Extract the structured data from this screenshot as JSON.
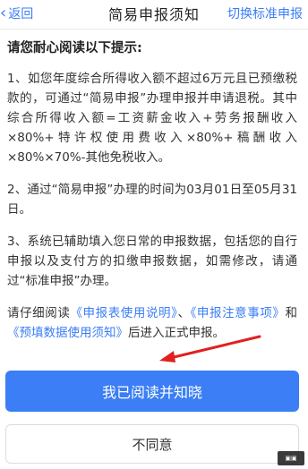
{
  "header": {
    "back_label": "返回",
    "title": "简易申报须知",
    "switch_label": "切换标准申报"
  },
  "notice": {
    "heading": "请您耐心阅读以下提示:",
    "item1": "1、如您年度综合所得收入额不超过6万元且已预缴税款的，可通过“简易申报”办理申报并申请退税。其中综合所得收入额=工资薪金收入+劳务报酬收入×80%+特许权使用费收入×80%+稿酬收入×80%×70%-其他免税收入。",
    "item2": "2、通过“简易申报”办理的时间为03月01日至05月31日。",
    "item3": "3、系统已辅助填入您日常的申报数据，包括您的自行申报以及支付方的扣缴申报数据，如需修改，请通过“标准申报”办理。",
    "read_prefix": "请仔细阅读",
    "link1": "《申报表使用说明》",
    "sep1": "、",
    "link2": "《申报注意事项》",
    "sep2": "和",
    "link3": "《预填数据使用须知》",
    "read_suffix": "后进入正式申报。"
  },
  "actions": {
    "agree_label": "我已阅读并知晓",
    "disagree_label": "不同意"
  },
  "colors": {
    "accent": "#3b7ef5",
    "arrow": "#e02020"
  }
}
